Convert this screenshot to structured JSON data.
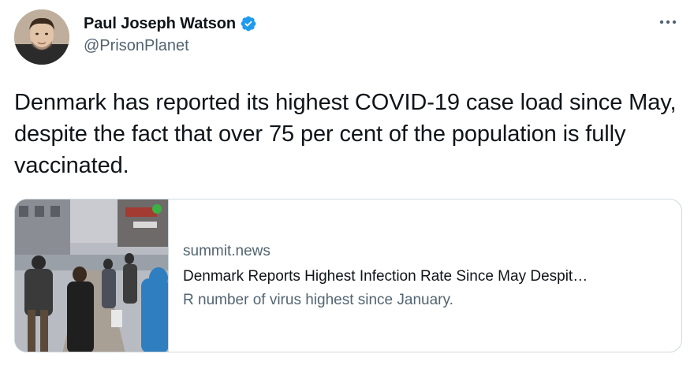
{
  "author": {
    "display_name": "Paul Joseph Watson",
    "handle": "@PrisonPlanet",
    "verified": true,
    "avatar_icon": "avatar-photo",
    "verified_icon": "verified-badge-icon",
    "verified_color": "#1d9bf0"
  },
  "more_icon": "more-options-icon",
  "tweet": {
    "text": "Denmark has reported its highest COVID-19 case load since May, despite the fact that over 75 per cent of the population is fully vaccinated."
  },
  "card": {
    "thumbnail_icon": "street-crowd-photo",
    "domain": "summit.news",
    "title": "Denmark Reports Highest Infection Rate Since May Despit…",
    "description": "R number of virus highest since January."
  }
}
